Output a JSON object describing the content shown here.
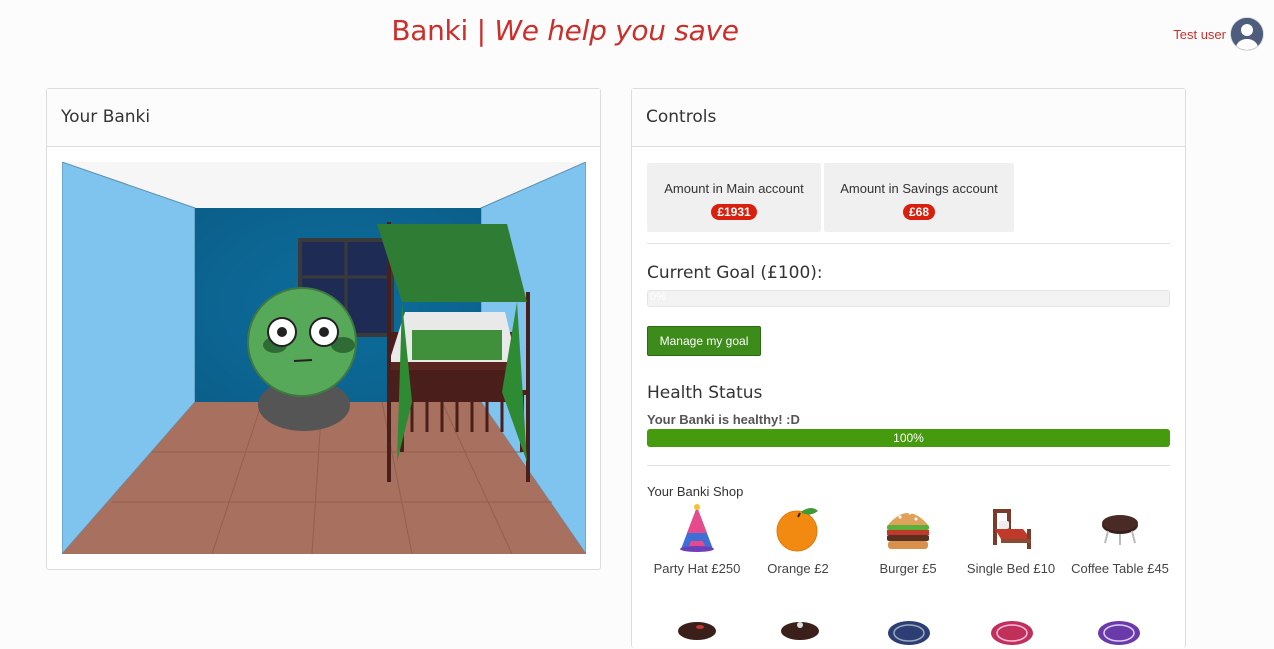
{
  "header": {
    "brand": "Banki",
    "separator": "|",
    "tagline": "We help you save"
  },
  "user": {
    "name": "Test user",
    "avatar_icon": "user-avatar-icon"
  },
  "left_panel": {
    "title": "Your Banki"
  },
  "controls": {
    "title": "Controls",
    "main_account": {
      "label": "Amount in Main account",
      "value": "£1931"
    },
    "savings_account": {
      "label": "Amount in Savings account",
      "value": "£68"
    },
    "goal": {
      "title": "Current Goal (£100):",
      "progress_text": "0%",
      "progress": 0,
      "button": "Manage my goal"
    },
    "health": {
      "title": "Health Status",
      "message": "Your Banki is healthy! :D",
      "value_text": "100%",
      "progress": 1.0
    },
    "shop": {
      "title": "Your Banki Shop",
      "items": [
        {
          "name": "Party Hat £250",
          "icon": "party-hat-icon"
        },
        {
          "name": "Orange £2",
          "icon": "orange-icon"
        },
        {
          "name": "Burger £5",
          "icon": "burger-icon"
        },
        {
          "name": "Single Bed £10",
          "icon": "single-bed-icon"
        },
        {
          "name": "Coffee Table £45",
          "icon": "coffee-table-icon"
        }
      ]
    }
  },
  "colors": {
    "brand": "#c9302c",
    "badge": "#d9200f",
    "button": "#3d8b1a",
    "health": "#469a0d"
  }
}
